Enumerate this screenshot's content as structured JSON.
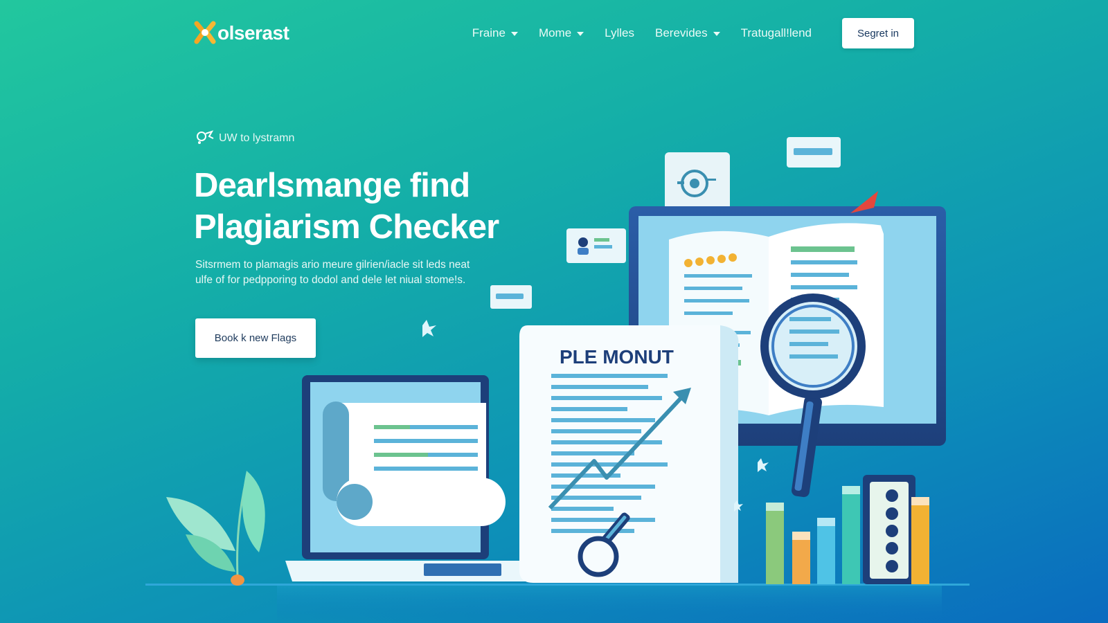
{
  "brand": {
    "name": "olserast"
  },
  "nav": {
    "items": [
      {
        "label": "Fraine",
        "has_dropdown": true
      },
      {
        "label": "Mome",
        "has_dropdown": true
      },
      {
        "label": "Lylles",
        "has_dropdown": false
      },
      {
        "label": "Berevides",
        "has_dropdown": true
      },
      {
        "label": "Tratugall!lend",
        "has_dropdown": false
      }
    ],
    "signin_label": "Segret in"
  },
  "hero": {
    "eyebrow": "UW to lystramn",
    "title_line1": "Dearlsmange find",
    "title_line2": "Plagiarism Checker",
    "description": "Sitsrmem to plamagis ario meure gilrien/iacle sit leds neat ulfe of for pedpporing to dodol and dele let niual stome!s.",
    "cta_label": "Book k new Flags"
  },
  "illustration": {
    "document_heading": "PLE MONUT"
  },
  "colors": {
    "bg_start": "#22c79e",
    "bg_end": "#0a6bbf",
    "logo_orange": "#f5a623",
    "navy": "#1d3f7a"
  }
}
